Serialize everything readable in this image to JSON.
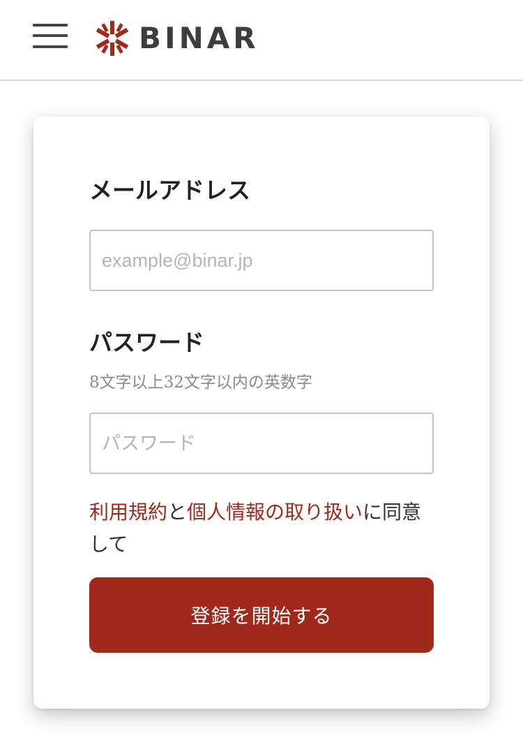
{
  "header": {
    "brand": "BINAR",
    "brand_color": "#a0291b"
  },
  "form": {
    "email_label": "メールアドレス",
    "email_placeholder": "example@binar.jp",
    "email_value": "",
    "password_label": "パスワード",
    "password_hint": "8文字以上32文字以内の英数字",
    "password_placeholder": "パスワード",
    "password_value": ""
  },
  "agreement": {
    "terms_link": "利用規約",
    "conjunction": "と",
    "privacy_link": "個人情報の取り扱い",
    "suffix": "に同意して"
  },
  "submit_label": "登録を開始する",
  "icons": {
    "menu": "hamburger-menu-icon",
    "logo": "binar-asterisk-logo-icon"
  }
}
